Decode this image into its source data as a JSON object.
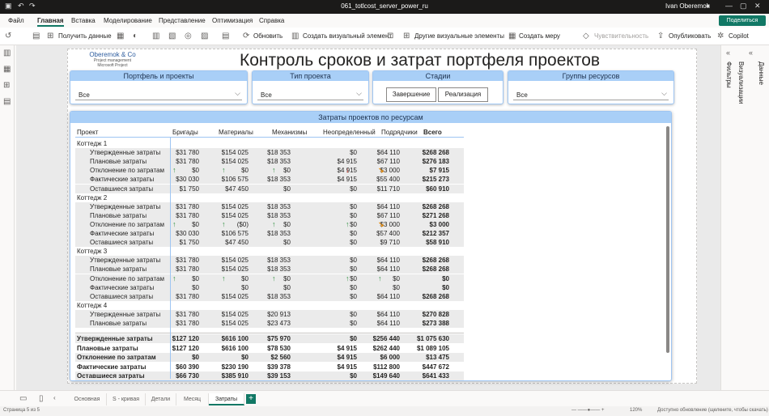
{
  "titlebar": {
    "file_name": "061_totlcost_server_power_ru",
    "user": "Ivan Oberemok"
  },
  "menu": {
    "items": [
      "Файл",
      "Главная",
      "Вставка",
      "Моделирование",
      "Представление",
      "Оптимизация",
      "Справка"
    ],
    "active": "Главная",
    "share": "Поделиться"
  },
  "ribbon": {
    "get_data": "Получить данные",
    "refresh": "Обновить",
    "new_visual": "Создать визуальный элемент",
    "more_visuals": "Другие визуальные элементы",
    "new_measure": "Создать меру",
    "sensitivity": "Чувствительность",
    "publish": "Опубликовать",
    "copilot": "Copilot"
  },
  "report": {
    "title": "Контроль сроков и затрат портфеля проектов",
    "logo": {
      "name": "Oberemok & Co",
      "line2": "Project management",
      "line3": "Microsoft Project"
    }
  },
  "slicers": [
    {
      "title": "Портфель и проекты",
      "value": "Все"
    },
    {
      "title": "Тип проекта",
      "value": "Все"
    },
    {
      "title": "Стадии",
      "buttons": [
        "Завершение",
        "Реализация"
      ]
    },
    {
      "title": "Группы ресурсов",
      "value": "Все"
    }
  ],
  "matrix": {
    "title": "Затраты проектов по ресурсам",
    "headers": [
      "Проект",
      "Бригады",
      "Материалы",
      "Механизмы",
      "Неопределенный",
      "Подрядчики",
      "Всего"
    ],
    "rows": [
      {
        "label": "Коттедж 1",
        "group": true
      },
      {
        "label": "Утвержденные затраты",
        "cells": [
          "$31 780",
          "$154 025",
          "$18 353",
          "$0",
          "$64 110",
          "$268 268"
        ]
      },
      {
        "label": "Плановые затраты",
        "cells": [
          "$31 780",
          "$154 025",
          "$18 353",
          "$4 915",
          "$67 110",
          "$276 183"
        ]
      },
      {
        "label": "Отклонение по затратам",
        "cells": [
          "$0",
          "$0",
          "$0",
          "$4 915",
          "$3 000",
          "$7 915"
        ],
        "arrows": [
          "up",
          "up",
          "up",
          "dn",
          "dr",
          ""
        ]
      },
      {
        "label": "Фактические затраты",
        "cells": [
          "$30 030",
          "$106 575",
          "$18 353",
          "$4 915",
          "$55 400",
          "$215 273"
        ]
      },
      {
        "label": "Оставшиеся затраты",
        "cells": [
          "$1 750",
          "$47 450",
          "$0",
          "$0",
          "$11 710",
          "$60 910"
        ]
      },
      {
        "label": "Коттедж 2",
        "group": true
      },
      {
        "label": "Утвержденные затраты",
        "cells": [
          "$31 780",
          "$154 025",
          "$18 353",
          "$0",
          "$64 110",
          "$268 268"
        ]
      },
      {
        "label": "Плановые затраты",
        "cells": [
          "$31 780",
          "$154 025",
          "$18 353",
          "$0",
          "$67 110",
          "$271 268"
        ]
      },
      {
        "label": "Отклонение по затратам",
        "cells": [
          "$0",
          "($0)",
          "$0",
          "$0",
          "$3 000",
          "$3 000"
        ],
        "arrows": [
          "up",
          "up",
          "up",
          "up",
          "dr",
          ""
        ]
      },
      {
        "label": "Фактические затраты",
        "cells": [
          "$30 030",
          "$106 575",
          "$18 353",
          "$0",
          "$57 400",
          "$212 357"
        ]
      },
      {
        "label": "Оставшиеся затраты",
        "cells": [
          "$1 750",
          "$47 450",
          "$0",
          "$0",
          "$9 710",
          "$58 910"
        ]
      },
      {
        "label": "Коттедж 3",
        "group": true
      },
      {
        "label": "Утвержденные затраты",
        "cells": [
          "$31 780",
          "$154 025",
          "$18 353",
          "$0",
          "$64 110",
          "$268 268"
        ]
      },
      {
        "label": "Плановые затраты",
        "cells": [
          "$31 780",
          "$154 025",
          "$18 353",
          "$0",
          "$64 110",
          "$268 268"
        ]
      },
      {
        "label": "Отклонение по затратам",
        "cells": [
          "$0",
          "$0",
          "$0",
          "$0",
          "$0",
          "$0"
        ],
        "arrows": [
          "up",
          "up",
          "up",
          "up",
          "up",
          ""
        ]
      },
      {
        "label": "Фактические затраты",
        "cells": [
          "$0",
          "$0",
          "$0",
          "$0",
          "$0",
          "$0"
        ]
      },
      {
        "label": "Оставшиеся затраты",
        "cells": [
          "$31 780",
          "$154 025",
          "$18 353",
          "$0",
          "$64 110",
          "$268 268"
        ]
      },
      {
        "label": "Коттедж 4",
        "group": true
      },
      {
        "label": "Утвержденные затраты",
        "cells": [
          "$31 780",
          "$154 025",
          "$20 913",
          "$0",
          "$64 110",
          "$270 828"
        ]
      },
      {
        "label": "Плановые затраты",
        "cells": [
          "$31 780",
          "$154 025",
          "$23 473",
          "$0",
          "$64 110",
          "$273 388"
        ]
      }
    ],
    "totals": [
      {
        "label": "Утвержденные затраты",
        "cells": [
          "$127 120",
          "$616 100",
          "$75 970",
          "$0",
          "$256 440",
          "$1 075 630"
        ]
      },
      {
        "label": "Плановые затраты",
        "cells": [
          "$127 120",
          "$616 100",
          "$78 530",
          "$4 915",
          "$262 440",
          "$1 089 105"
        ]
      },
      {
        "label": "Отклонение по затратам",
        "cells": [
          "$0",
          "$0",
          "$2 560",
          "$4 915",
          "$6 000",
          "$13 475"
        ]
      },
      {
        "label": "Фактические затраты",
        "cells": [
          "$60 390",
          "$230 190",
          "$39 378",
          "$4 915",
          "$112 800",
          "$447 672"
        ]
      },
      {
        "label": "Оставшиеся затраты",
        "cells": [
          "$66 730",
          "$385 910",
          "$39 153",
          "$0",
          "$149 640",
          "$641 433"
        ]
      }
    ]
  },
  "right_panel": {
    "filters": "Фильтры",
    "visuals": "Визуализации",
    "data": "Данные"
  },
  "tabs": [
    "Основная",
    "S - кривая",
    "Детали",
    "Месяц",
    "Затраты"
  ],
  "active_tab": "Затраты",
  "status": {
    "page": "Страница 5 из 5",
    "zoom": "120%",
    "update": "Доступно обновление (щелкните, чтобы скачать)"
  }
}
